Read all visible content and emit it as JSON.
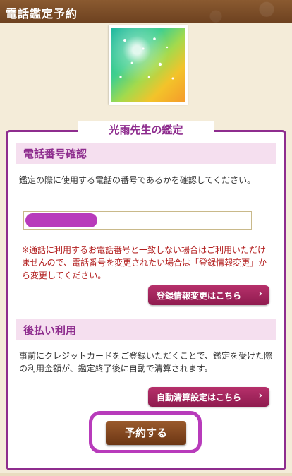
{
  "header": {
    "title": "電話鑑定予約"
  },
  "panel": {
    "title": "光雨先生の鑑定"
  },
  "phone_section": {
    "heading": "電話番号確認",
    "instruction": "鑑定の際に使用する電話の番号であるかを確認してください。",
    "phone_value": "",
    "warning": "※通話に利用するお電話番号と一致しない場合はご利用いただけませんので、電話番号を変更されたい場合は「登録情報変更」から変更してください。",
    "change_button": "登録情報変更はこちら"
  },
  "postpay_section": {
    "heading": "後払い利用",
    "description": "事前にクレジットカードをご登録いただくことで、鑑定を受けた際の利用金額が、鑑定終了後に自動で清算されます。",
    "settings_button": "自動清算設定はこちら"
  },
  "reserve_button": "予約する",
  "icons": {
    "chevron": "chevron-right-icon"
  },
  "colors": {
    "accent": "#8e2d8e",
    "header": "#7a4a24",
    "button": "#a0285c"
  }
}
